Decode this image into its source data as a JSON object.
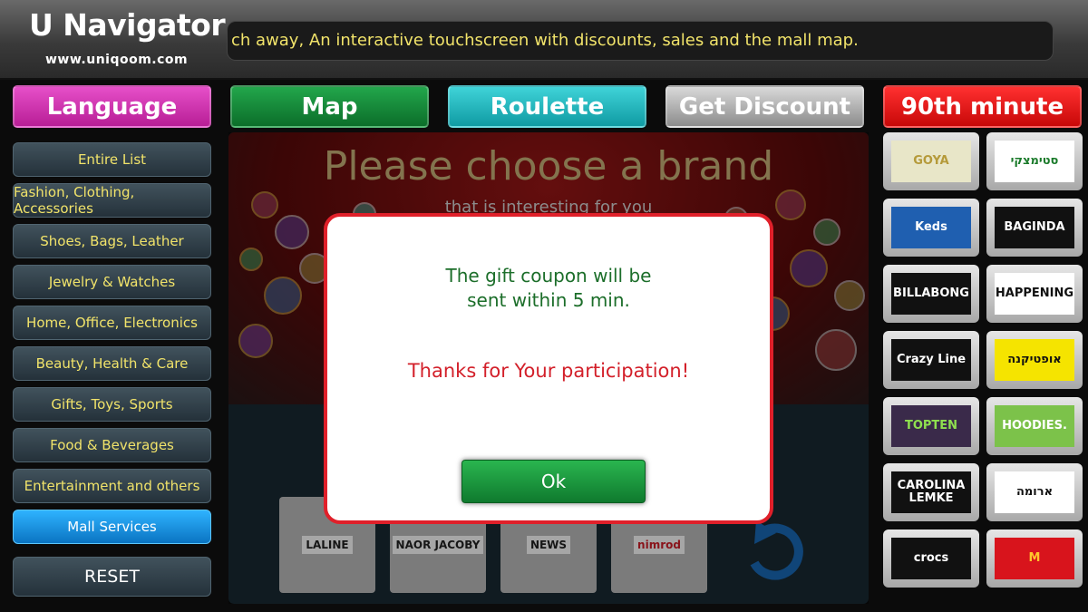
{
  "header": {
    "title": "U Navigator",
    "url": "www.uniqoom.com",
    "ticker": "ch away, An interactive touchscreen with discounts, sales and the mall map."
  },
  "top_buttons": {
    "language": "Language",
    "map": "Map",
    "roulette": "Roulette",
    "get_discount": "Get Discount",
    "ninetieth": "90th minute"
  },
  "sidebar": {
    "items": [
      {
        "label": "Entire List"
      },
      {
        "label": "Fashion, Clothing, Accessories"
      },
      {
        "label": "Shoes, Bags, Leather"
      },
      {
        "label": "Jewelry & Watches"
      },
      {
        "label": "Home, Office, Electronics"
      },
      {
        "label": "Beauty, Health & Care"
      },
      {
        "label": "Gifts, Toys, Sports"
      },
      {
        "label": "Food & Beverages"
      },
      {
        "label": "Entertainment and others"
      },
      {
        "label": "Mall Services"
      }
    ],
    "reset": "RESET"
  },
  "center": {
    "title": "Please choose a brand",
    "subtitle": "that is interesting for you",
    "bottom_tiles": [
      "LALINE",
      "NAOR JACOBY",
      "NEWS",
      "nimrod"
    ]
  },
  "right_brands": [
    {
      "label": "GOYA",
      "bg": "#e8e6c8",
      "fg": "#b59a3a"
    },
    {
      "label": "סטימצקי",
      "bg": "#ffffff",
      "fg": "#1a7a2a"
    },
    {
      "label": "Keds",
      "bg": "#1f5fb0",
      "fg": "#ffffff"
    },
    {
      "label": "BAGINDA",
      "bg": "#111111",
      "fg": "#ffffff"
    },
    {
      "label": "BILLABONG",
      "bg": "#111111",
      "fg": "#ffffff"
    },
    {
      "label": "HAPPENING",
      "bg": "#ffffff",
      "fg": "#111111"
    },
    {
      "label": "Crazy Line",
      "bg": "#111111",
      "fg": "#ffffff"
    },
    {
      "label": "אופטיקנה",
      "bg": "#f5e400",
      "fg": "#111111"
    },
    {
      "label": "TOPTEN",
      "bg": "#3a2a4a",
      "fg": "#8fe04f"
    },
    {
      "label": "HOODIES.",
      "bg": "#7cc24a",
      "fg": "#ffffff"
    },
    {
      "label": "CAROLINA LEMKE",
      "bg": "#111111",
      "fg": "#ffffff"
    },
    {
      "label": "ארומה",
      "bg": "#ffffff",
      "fg": "#111111"
    },
    {
      "label": "crocs",
      "bg": "#111111",
      "fg": "#ffffff"
    },
    {
      "label": "M",
      "bg": "#d8141c",
      "fg": "#ffc72c"
    }
  ],
  "modal": {
    "message_line1": "The gift coupon will be",
    "message_line2": "sent within 5 min.",
    "thanks": "Thanks for Your participation!",
    "ok": "Ok"
  }
}
